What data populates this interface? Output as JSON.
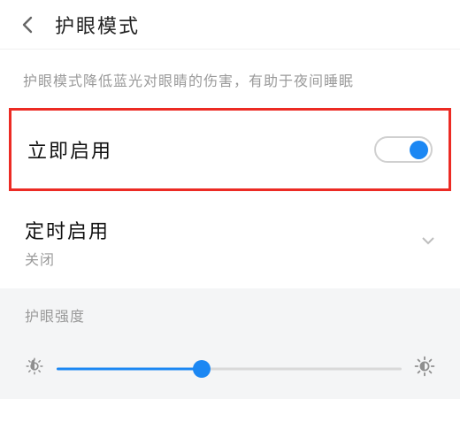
{
  "header": {
    "title": "护眼模式"
  },
  "description": "护眼模式降低蓝光对眼睛的伤害，有助于夜间睡眠",
  "enable_now": {
    "label": "立即启用",
    "state": "on"
  },
  "scheduled": {
    "label": "定时启用",
    "status": "关闭"
  },
  "intensity": {
    "label": "护眼强度",
    "value": 42,
    "min": 0,
    "max": 100
  },
  "colors": {
    "accent": "#1b87f3",
    "highlight_border": "#ec2b24"
  }
}
